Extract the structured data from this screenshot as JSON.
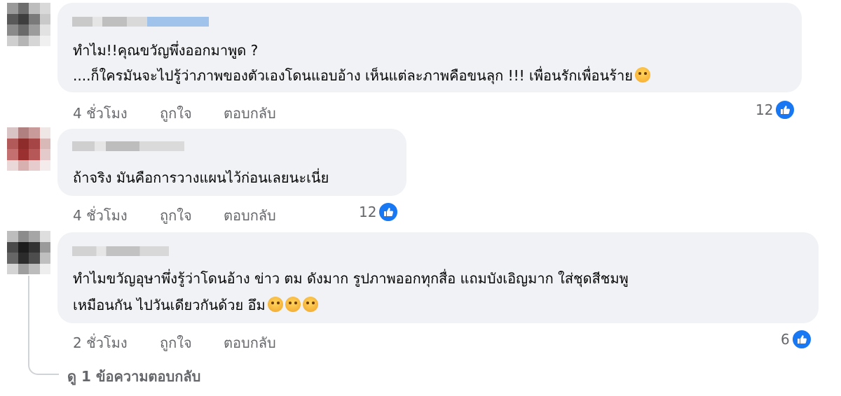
{
  "comments": [
    {
      "text_lines": [
        "ทำไม!!คุณขวัญพึ่งออกมาพูด ?",
        "....ก็ใครมันจะไปรู้ว่าภาพของตัวเองโดนแอบอ้าง เห็นแต่ละภาพคือขนลุก !!! เพื่อนรักเพื่อนร้าย"
      ],
      "time": "4 ชั่วโมง",
      "like_label": "ถูกใจ",
      "reply_label": "ตอบกลับ",
      "reaction_count": "12",
      "emojis": [
        "wink-emoji"
      ]
    },
    {
      "text_lines": [
        "ถ้าจริง มันคือการวางแผนไว้ก่อนเลยนะเนี่ย"
      ],
      "time": "4 ชั่วโมง",
      "like_label": "ถูกใจ",
      "reply_label": "ตอบกลับ",
      "reaction_count": "12",
      "emojis": []
    },
    {
      "text_lines": [
        "ทำไมขวัญอุษาพึ่งรู้ว่าโดนอ้าง ข่าว ตม ดังมาก รูปภาพออกทุกสื่อ แถมบังเอิญมาก ใส่ชุดสีชมพู",
        "เหมือนกัน ไปวันเดียวกันด้วย อึม"
      ],
      "time": "2 ชั่วโมง",
      "like_label": "ถูกใจ",
      "reply_label": "ตอบกลับ",
      "reaction_count": "6",
      "emojis": [
        "dizzy-emoji",
        "dizzy-emoji",
        "dizzy-emoji"
      ]
    }
  ],
  "view_replies": "ดู 1 ข้อความตอบกลับ",
  "colors": {
    "bubble": "#f0f2f5",
    "meta_text": "#65676b",
    "like_blue": "#1877f2"
  },
  "icons": [
    "like-icon"
  ]
}
